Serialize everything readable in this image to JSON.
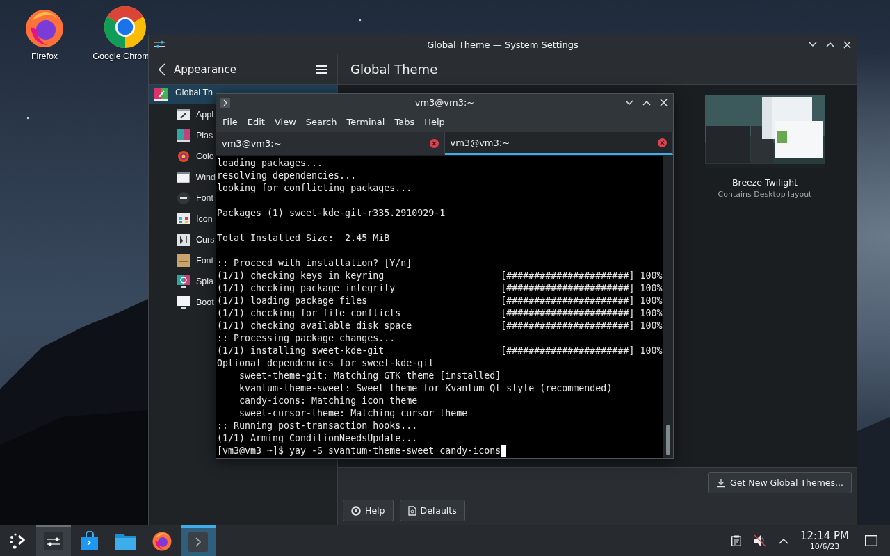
{
  "desktop_icons": [
    {
      "kind": "firefox",
      "label": "Firefox"
    },
    {
      "kind": "chrome",
      "label": "Google Chrom"
    }
  ],
  "settings_window": {
    "title": "Global Theme — System Settings",
    "sidebar_title": "Appearance",
    "page_title": "Global Theme",
    "sidebar_items": [
      {
        "kind": "global",
        "label": "Global Th",
        "selected": true
      },
      {
        "kind": "app",
        "label": "Appl",
        "selected": false
      },
      {
        "kind": "plasma",
        "label": "Plas",
        "selected": false
      },
      {
        "kind": "colors",
        "label": "Colo",
        "selected": false
      },
      {
        "kind": "window",
        "label": "Wind",
        "selected": false
      },
      {
        "kind": "fonts",
        "label": "Font",
        "selected": false
      },
      {
        "kind": "icons",
        "label": "Icon",
        "selected": false
      },
      {
        "kind": "cursor",
        "label": "Curs",
        "selected": false
      },
      {
        "kind": "fontmgmt",
        "label": "Font",
        "selected": false
      },
      {
        "kind": "splash",
        "label": "Spla",
        "selected": false
      },
      {
        "kind": "boot",
        "label": "Boot",
        "selected": false
      }
    ],
    "theme_card": {
      "name": "Breeze Twilight",
      "subtitle": "Contains Desktop layout"
    },
    "get_new_button": "Get New Global Themes...",
    "footer_buttons": [
      {
        "kind": "help",
        "label": "Help"
      },
      {
        "kind": "defaults",
        "label": "Defaults"
      }
    ]
  },
  "terminal_window": {
    "title": "vm3@vm3:~",
    "menu": [
      "File",
      "Edit",
      "View",
      "Search",
      "Terminal",
      "Tabs",
      "Help"
    ],
    "tabs": [
      {
        "label": "vm3@vm3:~",
        "selected": false
      },
      {
        "label": "vm3@vm3:~",
        "selected": true
      }
    ],
    "lines": [
      {
        "kind": "text",
        "text": "loading packages..."
      },
      {
        "kind": "text",
        "text": "resolving dependencies..."
      },
      {
        "kind": "text",
        "text": "looking for conflicting packages..."
      },
      {
        "kind": "blank"
      },
      {
        "kind": "text",
        "text": "Packages (1) sweet-kde-git-r335.2910929-1"
      },
      {
        "kind": "blank"
      },
      {
        "kind": "text",
        "text": "Total Installed Size:  2.45 MiB"
      },
      {
        "kind": "blank"
      },
      {
        "kind": "text",
        "text": ":: Proceed with installation? [Y/n]"
      },
      {
        "kind": "progress",
        "text": "(1/1) checking keys in keyring",
        "bar": "[######################] 100%"
      },
      {
        "kind": "progress",
        "text": "(1/1) checking package integrity",
        "bar": "[######################] 100%"
      },
      {
        "kind": "progress",
        "text": "(1/1) loading package files",
        "bar": "[######################] 100%"
      },
      {
        "kind": "progress",
        "text": "(1/1) checking for file conflicts",
        "bar": "[######################] 100%"
      },
      {
        "kind": "progress",
        "text": "(1/1) checking available disk space",
        "bar": "[######################] 100%"
      },
      {
        "kind": "text",
        "text": ":: Processing package changes..."
      },
      {
        "kind": "progress",
        "text": "(1/1) installing sweet-kde-git",
        "bar": "[######################] 100%"
      },
      {
        "kind": "text",
        "text": "Optional dependencies for sweet-kde-git"
      },
      {
        "kind": "text",
        "text": "    sweet-theme-git: Matching GTK theme [installed]"
      },
      {
        "kind": "text",
        "text": "    kvantum-theme-sweet: Sweet theme for Kvantum Qt style (recommended)"
      },
      {
        "kind": "text",
        "text": "    candy-icons: Matching icon theme"
      },
      {
        "kind": "text",
        "text": "    sweet-cursor-theme: Matching cursor theme"
      },
      {
        "kind": "text",
        "text": ":: Running post-transaction hooks..."
      },
      {
        "kind": "text",
        "text": "(1/1) Arming ConditionNeedsUpdate..."
      },
      {
        "kind": "prompt",
        "text": "[vm3@vm3 ~]$ yay -S svantum-theme-sweet candy-icons"
      }
    ]
  },
  "taskbar": {
    "tasks": [
      {
        "kind": "launcher",
        "open": false,
        "selected": false
      },
      {
        "kind": "settings",
        "open": true,
        "selected": false
      },
      {
        "kind": "discover",
        "open": false,
        "selected": false
      },
      {
        "kind": "files",
        "open": false,
        "selected": false
      },
      {
        "kind": "firefox",
        "open": false,
        "selected": false
      },
      {
        "kind": "terminal",
        "open": true,
        "selected": true
      }
    ],
    "time": "12:14 PM",
    "date": "10/6/23"
  }
}
